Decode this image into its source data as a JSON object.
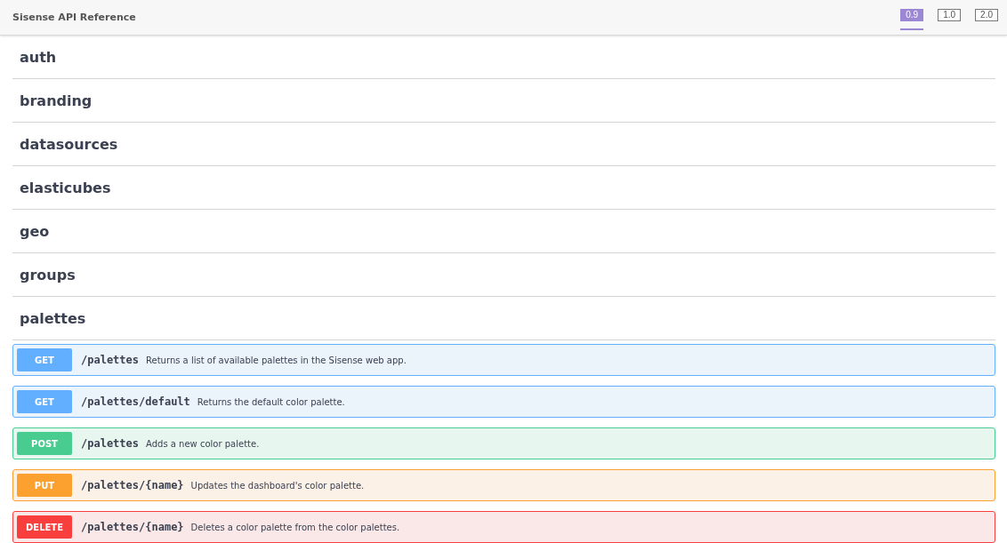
{
  "header": {
    "title": "Sisense API Reference",
    "versions": [
      {
        "label": "0.9",
        "selected": true
      },
      {
        "label": "1.0",
        "selected": false
      },
      {
        "label": "2.0",
        "selected": false
      }
    ]
  },
  "tags": [
    {
      "name": "auth"
    },
    {
      "name": "branding"
    },
    {
      "name": "datasources"
    },
    {
      "name": "elasticubes"
    },
    {
      "name": "geo"
    },
    {
      "name": "groups"
    },
    {
      "name": "palettes",
      "operations": [
        {
          "kind": "get",
          "method": "GET",
          "path": "/palettes",
          "summary": "Returns a list of available palettes in the Sisense web app."
        },
        {
          "kind": "get",
          "method": "GET",
          "path": "/palettes/default",
          "summary": "Returns the default color palette."
        },
        {
          "kind": "post",
          "method": "POST",
          "path": "/palettes",
          "summary": "Adds a new color palette."
        },
        {
          "kind": "put",
          "method": "PUT",
          "path": "/palettes/{name}",
          "summary": "Updates the dashboard's color palette."
        },
        {
          "kind": "delete",
          "method": "DELETE",
          "path": "/palettes/{name}",
          "summary": "Deletes a color palette from the color palettes."
        }
      ]
    }
  ]
}
